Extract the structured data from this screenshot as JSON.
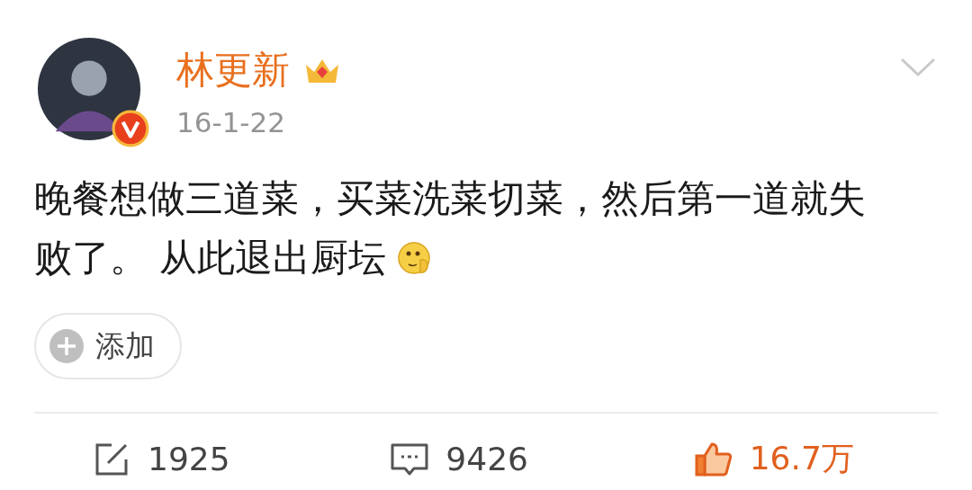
{
  "author": {
    "name": "林更新",
    "verified": true,
    "date": "16-1-22"
  },
  "post": {
    "lines": [
      "晚餐想做三道菜，买菜洗菜切菜，然后第一道就失",
      "败了。 从此退出厨坛"
    ]
  },
  "add_button": {
    "label": "添加"
  },
  "actions": [
    {
      "kind": "repost",
      "count": "1925",
      "selected": false
    },
    {
      "kind": "comment",
      "count": "9426",
      "selected": false
    },
    {
      "kind": "like",
      "count": "16.7万",
      "selected": true
    }
  ]
}
